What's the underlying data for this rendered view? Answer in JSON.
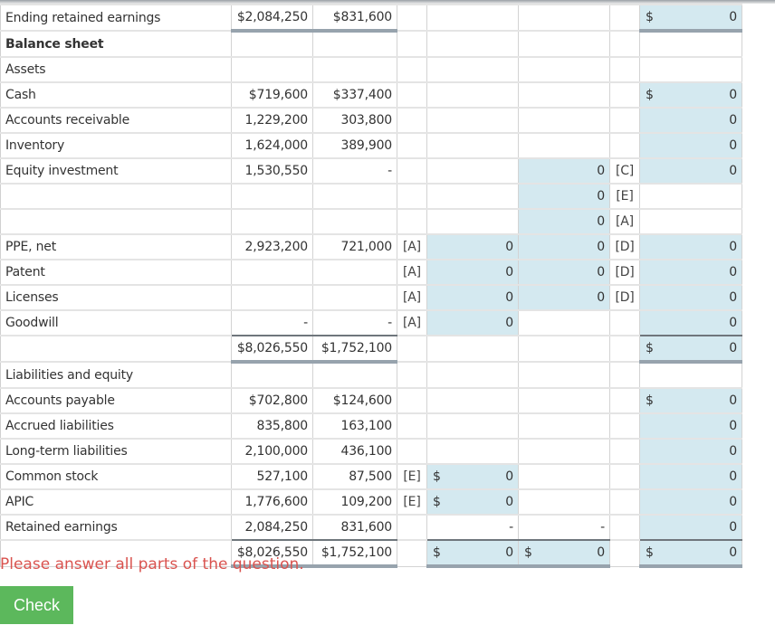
{
  "rows": [
    {
      "label": "Ending retained earnings",
      "parent": "$2,084,250",
      "sub": "$831,600",
      "ref1": "",
      "adj1": null,
      "adj2": null,
      "ref2": "",
      "cons": {
        "cur": "$",
        "val": "0"
      },
      "style": "total"
    },
    {
      "label": "Balance sheet",
      "bold": true
    },
    {
      "label": "Assets"
    },
    {
      "label": "Cash",
      "parent": "$719,600",
      "sub": "$337,400",
      "cons": {
        "cur": "$",
        "val": "0"
      }
    },
    {
      "label": "Accounts receivable",
      "parent": "1,229,200",
      "sub": "303,800",
      "cons": {
        "cur": "",
        "val": "0"
      }
    },
    {
      "label": "Inventory",
      "parent": "1,624,000",
      "sub": "389,900",
      "cons": {
        "cur": "",
        "val": "0"
      }
    },
    {
      "label": "Equity investment",
      "parent": "1,530,550",
      "sub": "-",
      "adj2": {
        "cur": "",
        "val": "0"
      },
      "ref2": "[C]",
      "cons": {
        "cur": "",
        "val": "0"
      }
    },
    {
      "label": "",
      "adj2": {
        "cur": "",
        "val": "0"
      },
      "ref2": "[E]"
    },
    {
      "label": "",
      "adj2": {
        "cur": "",
        "val": "0"
      },
      "ref2": "[A]"
    },
    {
      "label": "PPE, net",
      "parent": "2,923,200",
      "sub": "721,000",
      "ref1": "[A]",
      "adj1": {
        "cur": "",
        "val": "0"
      },
      "adj2": {
        "cur": "",
        "val": "0"
      },
      "ref2": "[D]",
      "cons": {
        "cur": "",
        "val": "0"
      }
    },
    {
      "label": "Patent",
      "ref1": "[A]",
      "adj1": {
        "cur": "",
        "val": "0"
      },
      "adj2": {
        "cur": "",
        "val": "0"
      },
      "ref2": "[D]",
      "cons": {
        "cur": "",
        "val": "0"
      }
    },
    {
      "label": "Licenses",
      "ref1": "[A]",
      "adj1": {
        "cur": "",
        "val": "0"
      },
      "adj2": {
        "cur": "",
        "val": "0"
      },
      "ref2": "[D]",
      "cons": {
        "cur": "",
        "val": "0"
      }
    },
    {
      "label": "Goodwill",
      "parent": "-",
      "sub": "-",
      "ref1": "[A]",
      "adj1": {
        "cur": "",
        "val": "0"
      },
      "cons": {
        "cur": "",
        "val": "0"
      }
    },
    {
      "label": "",
      "parent": "$8,026,550",
      "sub": "$1,752,100",
      "cons": {
        "cur": "$",
        "val": "0"
      },
      "style": "total"
    },
    {
      "label": "Liabilities and equity"
    },
    {
      "label": "Accounts payable",
      "parent": "$702,800",
      "sub": "$124,600",
      "cons": {
        "cur": "$",
        "val": "0"
      }
    },
    {
      "label": "Accrued liabilities",
      "parent": "835,800",
      "sub": "163,100",
      "cons": {
        "cur": "",
        "val": "0"
      }
    },
    {
      "label": "Long-term liabilities",
      "parent": "2,100,000",
      "sub": "436,100",
      "cons": {
        "cur": "",
        "val": "0"
      }
    },
    {
      "label": "Common stock",
      "parent": "527,100",
      "sub": "87,500",
      "ref1": "[E]",
      "adj1": {
        "cur": "$",
        "val": "0"
      },
      "cons": {
        "cur": "",
        "val": "0"
      }
    },
    {
      "label": "APIC",
      "parent": "1,776,600",
      "sub": "109,200",
      "ref1": "[E]",
      "adj1": {
        "cur": "$",
        "val": "0"
      },
      "cons": {
        "cur": "",
        "val": "0"
      }
    },
    {
      "label": "Retained earnings",
      "parent": "2,084,250",
      "sub": "831,600",
      "adj1text": "-",
      "adj2text": "-",
      "cons": {
        "cur": "",
        "val": "0"
      }
    },
    {
      "label": "",
      "parent": "$8,026,550",
      "sub": "$1,752,100",
      "adj1": {
        "cur": "$",
        "val": "0"
      },
      "adj2": {
        "cur": "$",
        "val": "0"
      },
      "cons": {
        "cur": "$",
        "val": "0"
      },
      "style": "total"
    }
  ],
  "message": "Please answer all parts of the question.",
  "check_label": "Check"
}
